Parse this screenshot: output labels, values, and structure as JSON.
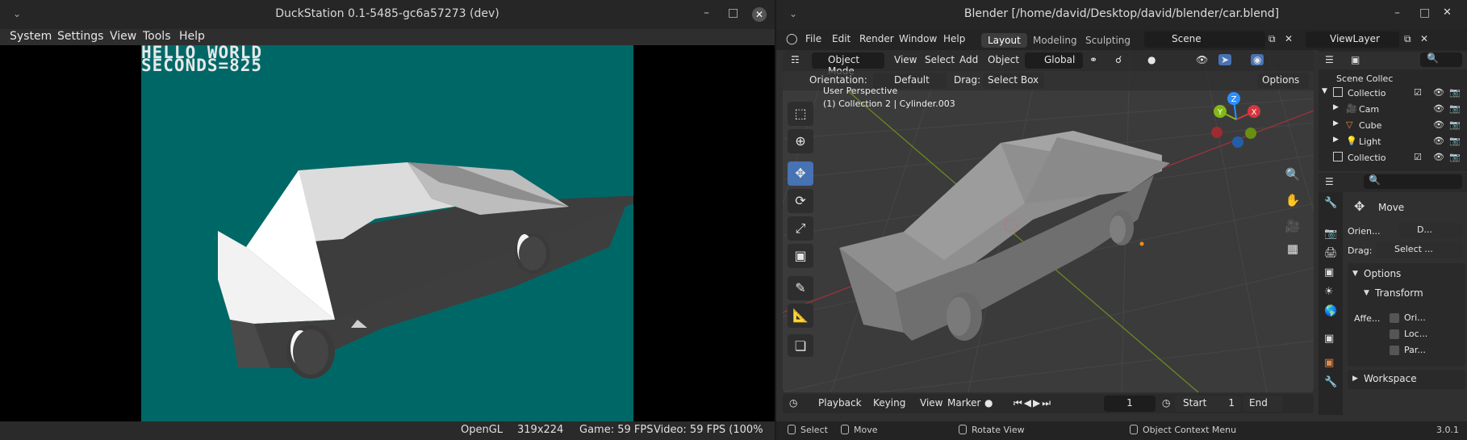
{
  "duckstation": {
    "title": "DuckStation 0.1-5485-gc6a57273 (dev)",
    "menu": [
      "System",
      "Settings",
      "View",
      "Tools",
      "Help"
    ],
    "game_text": {
      "line1": "HELLO WORLD",
      "line2": "SECONDS=825"
    },
    "status": {
      "renderer": "OpenGL",
      "resolution": "319x224",
      "game_fps": "Game: 59 FPS",
      "video_fps": "Video: 59 FPS (100%"
    },
    "colors": {
      "game_bg": "#006767"
    }
  },
  "blender": {
    "title": "Blender [/home/david/Desktop/david/blender/car.blend]",
    "menu": [
      "File",
      "Edit",
      "Render",
      "Window",
      "Help"
    ],
    "workspaces": [
      "Layout",
      "Modeling",
      "Sculpting"
    ],
    "scene": "Scene",
    "view_layer": "ViewLayer",
    "viewport_header": {
      "mode": "Object Mode",
      "menus": [
        "View",
        "Select",
        "Add",
        "Object"
      ],
      "orientation": "Global"
    },
    "tool_settings": {
      "orientation_label": "Orientation:",
      "orientation_value": "Default",
      "drag_label": "Drag:",
      "drag_value": "Select Box",
      "options": "Options"
    },
    "viewport_overlay": {
      "perspective": "User Perspective",
      "collection": "(1) Collection 2 | Cylinder.003"
    },
    "gizmo": {
      "x": "X",
      "y": "Y",
      "z": "Z"
    },
    "outliner": {
      "title": "Scene Collec",
      "rows": [
        "Collectio",
        "Cam",
        "Cube",
        "Light",
        "Collectio"
      ]
    },
    "properties": {
      "tool_name": "Move",
      "orient_label": "Orien...",
      "orient_value": "D...",
      "drag_label": "Drag:",
      "drag_value": "Select ...",
      "options_panel": "Options",
      "transform_panel": "Transform",
      "affect_label": "Affe...",
      "affect_options": [
        "Ori...",
        "Loc...",
        "Par..."
      ],
      "workspace_panel": "Workspace"
    },
    "timeline": {
      "menus": [
        "Playback",
        "Keying",
        "View",
        "Marker"
      ],
      "current_frame": "1",
      "start_label": "Start",
      "start_value": "1",
      "end_label": "End"
    },
    "statusbar": {
      "select": "Select",
      "move": "Move",
      "rotate": "Rotate View",
      "context": "Object Context Menu",
      "version": "3.0.1"
    },
    "colors": {
      "accent": "#4772b3",
      "axis_x": "#d5363f",
      "axis_y": "#83b817",
      "axis_z": "#2c8fff"
    }
  },
  "icons": [
    "chevron-down-icon",
    "minimize-icon",
    "maximize-icon",
    "close-icon",
    "blender-logo-icon",
    "cursor-icon",
    "move-icon",
    "rotate-icon",
    "scale-icon",
    "transform-icon",
    "annotate-icon",
    "measure-icon",
    "add-cube-icon",
    "zoom-icon",
    "hand-icon",
    "camera-icon",
    "grid-icon",
    "eye-icon",
    "camera-render-icon",
    "play-icon"
  ]
}
